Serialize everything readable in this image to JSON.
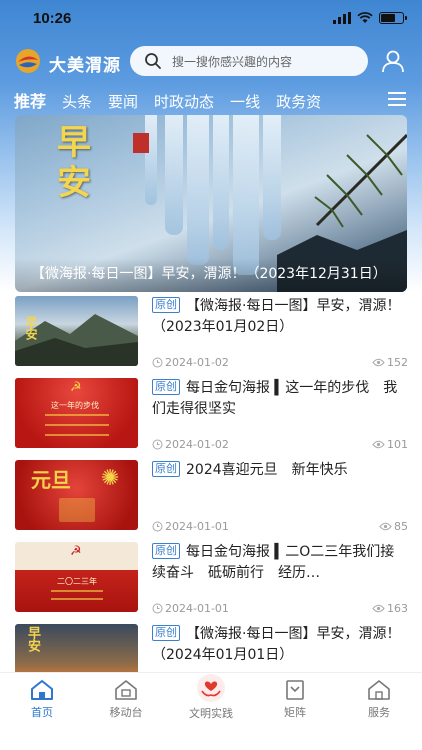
{
  "status_bar": {
    "time": "10:26"
  },
  "header": {
    "app_title": "大美渭源",
    "search_placeholder": "搜一搜你感兴趣的内容"
  },
  "tabs": [
    {
      "label": "推荐",
      "active": true
    },
    {
      "label": "头条",
      "active": false
    },
    {
      "label": "要闻",
      "active": false
    },
    {
      "label": "时政动态",
      "active": false
    },
    {
      "label": "一线",
      "active": false
    },
    {
      "label": "政务资",
      "active": false
    }
  ],
  "banner": {
    "poster_text": "早安",
    "caption": "【微海报·每日一图】早安，渭源！（2023年12月31日）"
  },
  "news": [
    {
      "badge": "原创",
      "title": "【微海报·每日一图】早安，渭源！（2023年01月02日）",
      "date": "2024-01-02",
      "views": "152",
      "thumb_text": "早安"
    },
    {
      "badge": "原创",
      "title": "每日金句海报 ▍这一年的步伐　我们走得很坚实",
      "date": "2024-01-02",
      "views": "101",
      "thumb_text": "这一年的步伐"
    },
    {
      "badge": "原创",
      "title": "2024喜迎元旦　新年快乐",
      "date": "2024-01-01",
      "views": "85",
      "thumb_text": "元旦"
    },
    {
      "badge": "原创",
      "title": "每日金句海报 ▍二O二三年我们接续奋斗　砥砺前行　经历…",
      "date": "2024-01-01",
      "views": "163",
      "thumb_text": "二〇二三年"
    },
    {
      "badge": "原创",
      "title": "【微海报·每日一图】早安，渭源！（2024年01月01日）",
      "date": "",
      "views": "",
      "thumb_text": "早安"
    }
  ],
  "bottom_nav": [
    {
      "label": "首页",
      "icon": "home-icon",
      "active": true
    },
    {
      "label": "移动台",
      "icon": "tv-icon",
      "active": false
    },
    {
      "label": "文明实践",
      "icon": "heart-hands-icon",
      "active": false
    },
    {
      "label": "矩阵",
      "icon": "matrix-icon",
      "active": false
    },
    {
      "label": "服务",
      "icon": "service-icon",
      "active": false
    }
  ],
  "colors": {
    "accent": "#2d77cf",
    "badge": "#3a7fd0",
    "header": "#4a8fd8"
  }
}
